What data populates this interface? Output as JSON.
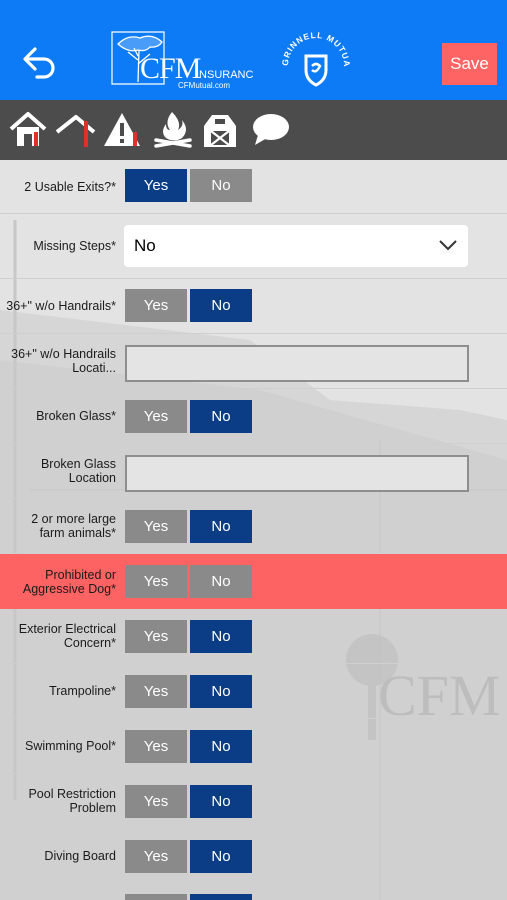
{
  "header": {
    "back_icon": "back-arrow-icon",
    "logo_brand": "CFM",
    "logo_insurance": "INSURANCE",
    "logo_url": "CFMutual.com",
    "badge_text": "GRINNELL MUTUAL MEMBER",
    "save_label": "Save",
    "colors": {
      "bar": "#0d7bf5",
      "save": "#fd6463"
    }
  },
  "toolbar": {
    "icons": [
      "house-icon",
      "roof-icon",
      "hazard-warning-icon",
      "fire-icon",
      "barn-icon",
      "comment-icon"
    ],
    "background": "#4c4c4c"
  },
  "form": {
    "rows": [
      {
        "label": "2 Usable Exits?*",
        "type": "yesno",
        "yes": "Yes",
        "no": "No",
        "selected": "Yes"
      },
      {
        "label": "Missing Steps*",
        "type": "select",
        "value": "No"
      },
      {
        "label": "36+\" w/o Handrails*",
        "type": "yesno",
        "yes": "Yes",
        "no": "No",
        "selected": "No"
      },
      {
        "label": "36+\" w/o Handrails Locati...",
        "type": "text",
        "value": ""
      },
      {
        "label": "Broken Glass*",
        "type": "yesno",
        "yes": "Yes",
        "no": "No",
        "selected": "No"
      },
      {
        "label": "Broken Glass Location",
        "type": "text",
        "value": ""
      },
      {
        "label": "2 or more large farm animals*",
        "type": "yesno",
        "yes": "Yes",
        "no": "No",
        "selected": "No"
      },
      {
        "label": "Prohibited or Aggressive Dog*",
        "type": "yesno",
        "yes": "Yes",
        "no": "No",
        "selected": "none",
        "highlight": "#fd6363"
      },
      {
        "label": "Exterior Electrical Concern*",
        "type": "yesno",
        "yes": "Yes",
        "no": "No",
        "selected": "No"
      },
      {
        "label": "Trampoline*",
        "type": "yesno",
        "yes": "Yes",
        "no": "No",
        "selected": "No"
      },
      {
        "label": "Swimming Pool*",
        "type": "yesno",
        "yes": "Yes",
        "no": "No",
        "selected": "No"
      },
      {
        "label": "Pool Restriction Problem",
        "type": "yesno",
        "yes": "Yes",
        "no": "No",
        "selected": "No"
      },
      {
        "label": "Diving Board",
        "type": "yesno",
        "yes": "Yes",
        "no": "No",
        "selected": "No"
      }
    ],
    "watermark_text": "CFM",
    "selected_color": "#0a3d85",
    "unselected_color": "#8a8a8a"
  }
}
